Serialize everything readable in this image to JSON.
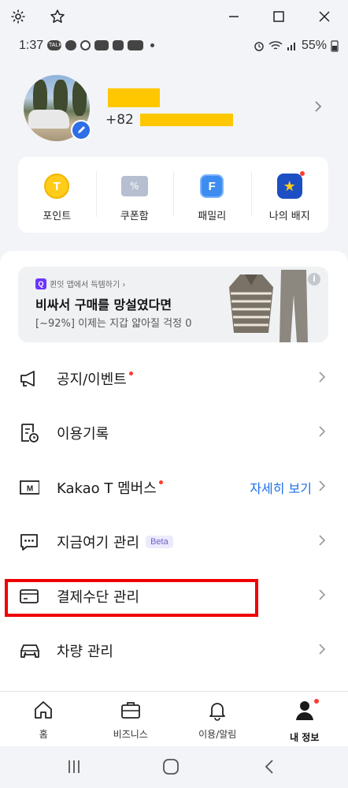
{
  "status_bar": {
    "time": "1:37",
    "battery": "55%",
    "notif_icons": [
      "TALK",
      "",
      "",
      "",
      "",
      ""
    ]
  },
  "profile": {
    "phone_prefix": "+82"
  },
  "quick_menu": [
    {
      "label": "포인트",
      "icon": "point-coin-icon"
    },
    {
      "label": "쿠폰함",
      "icon": "coupon-icon"
    },
    {
      "label": "패밀리",
      "icon": "family-icon"
    },
    {
      "label": "나의 배지",
      "icon": "badge-icon"
    }
  ],
  "ad": {
    "source": "퀸잇 앱에서 득템하기 ›",
    "title": "비싸서 구매를 망설였다면",
    "subtitle": "[~92%] 이제는 지갑 얇아질 걱정 0"
  },
  "menu": {
    "notice": "공지/이벤트",
    "history": "이용기록",
    "members": "Kakao T 멤버스",
    "members_detail": "자세히 보기",
    "here_now": "지금여기 관리",
    "beta": "Beta",
    "payment": "결제수단 관리",
    "vehicle": "차량 관리"
  },
  "tabs": [
    {
      "label": "홈",
      "icon": "home-icon"
    },
    {
      "label": "비즈니스",
      "icon": "briefcase-icon"
    },
    {
      "label": "이용/알림",
      "icon": "bell-icon"
    },
    {
      "label": "내 정보",
      "icon": "person-icon",
      "active": true
    }
  ],
  "colors": {
    "accent_blue": "#1e6fe8",
    "highlight_red": "#f00000",
    "mask_yellow": "#ffc700"
  }
}
